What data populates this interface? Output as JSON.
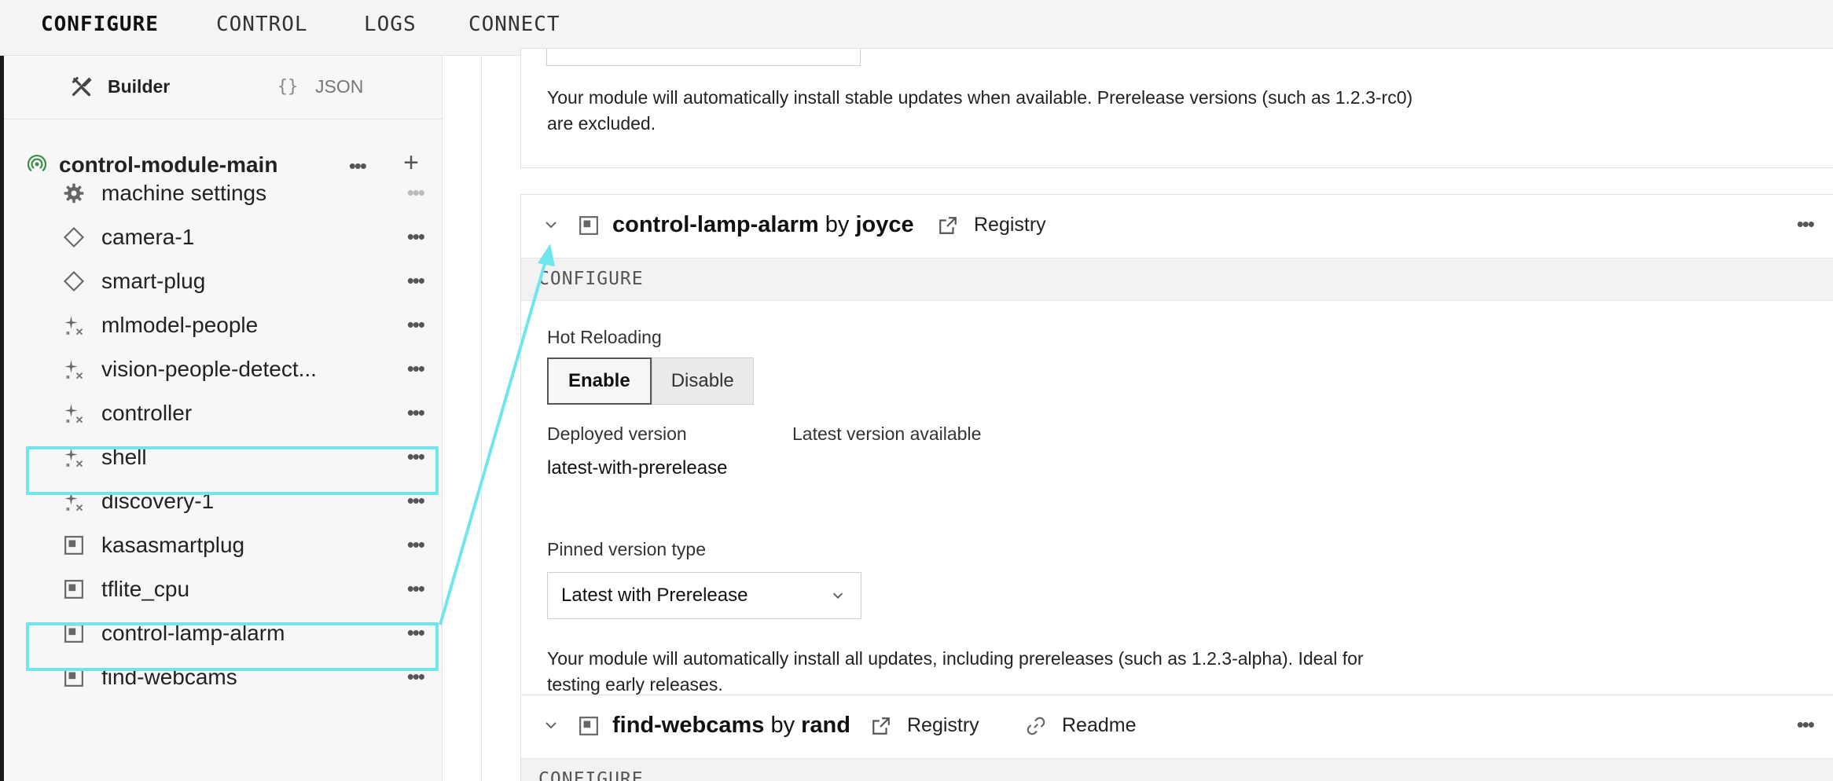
{
  "topnav": {
    "tabs": [
      {
        "label": "CONFIGURE"
      },
      {
        "label": "CONTROL"
      },
      {
        "label": "LOGS"
      },
      {
        "label": "CONNECT"
      }
    ]
  },
  "sidebar": {
    "modes": {
      "builder": "Builder",
      "json": "JSON",
      "json_icon": "{}"
    },
    "root": {
      "label": "control-module-main",
      "icon": "signal-icon"
    },
    "items": [
      {
        "label": "machine settings",
        "icon": "gear-icon"
      },
      {
        "label": "camera-1",
        "icon": "diamond-icon"
      },
      {
        "label": "smart-plug",
        "icon": "diamond-icon"
      },
      {
        "label": "mlmodel-people",
        "icon": "sparkle-icon"
      },
      {
        "label": "vision-people-detect...",
        "icon": "sparkle-icon"
      },
      {
        "label": "controller",
        "icon": "sparkle-icon"
      },
      {
        "label": "shell",
        "icon": "sparkle-icon"
      },
      {
        "label": "discovery-1",
        "icon": "sparkle-icon"
      },
      {
        "label": "kasasmartplug",
        "icon": "module-icon"
      },
      {
        "label": "tflite_cpu",
        "icon": "module-icon"
      },
      {
        "label": "control-lamp-alarm",
        "icon": "module-icon"
      },
      {
        "label": "find-webcams",
        "icon": "module-icon"
      }
    ]
  },
  "main": {
    "card1": {
      "description_line1": "Your module will automatically install stable updates when available. Prerelease versions (such as 1.2.3-rc0)",
      "description_line2": "are excluded."
    },
    "card2": {
      "name": "control-lamp-alarm",
      "by": "by",
      "author": "joyce",
      "registry_link": "Registry",
      "section": "CONFIGURE",
      "hot_reloading_label": "Hot Reloading",
      "enable": "Enable",
      "disable": "Disable",
      "deployed_version_label": "Deployed version",
      "deployed_version": "latest-with-prerelease",
      "latest_version_label": "Latest version available",
      "pinned_type_label": "Pinned version type",
      "pinned_type_value": "Latest with Prerelease",
      "description_line1": "Your module will automatically install all updates, including prereleases (such as 1.2.3-alpha). Ideal for",
      "description_line2": "testing early releases."
    },
    "card3": {
      "name": "find-webcams",
      "by": "by",
      "author": "rand",
      "registry_link": "Registry",
      "readme_link": "Readme",
      "section": "CONFIGURE"
    }
  },
  "colors": {
    "highlight": "#6fe6ec",
    "signal_green": "#3a8a4a"
  }
}
